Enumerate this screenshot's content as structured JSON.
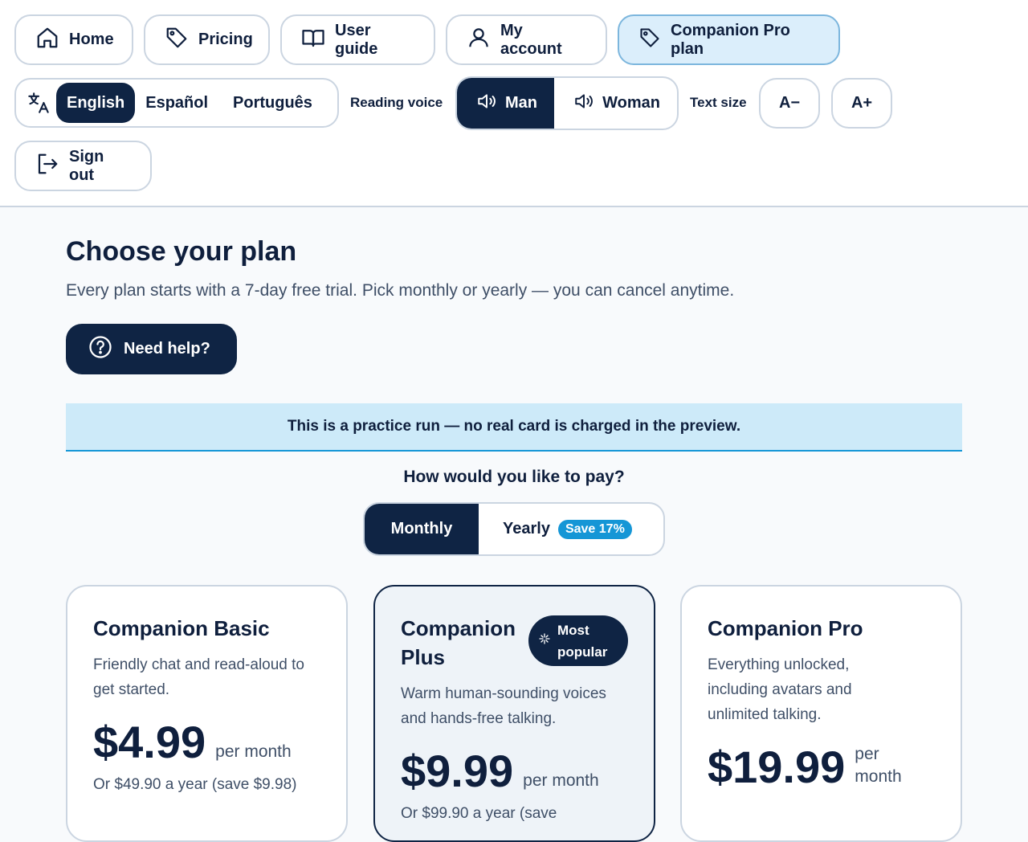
{
  "nav": {
    "home": "Home",
    "pricing": "Pricing",
    "user_guide": "User guide",
    "my_account": "My account",
    "pro_plan": "Companion Pro plan",
    "sign_out": "Sign out"
  },
  "language": {
    "options": [
      "English",
      "Español",
      "Português"
    ],
    "selected": "English"
  },
  "voice": {
    "label": "Reading voice",
    "options": [
      "Man",
      "Woman"
    ],
    "selected": "Man"
  },
  "text_size": {
    "label": "Text size",
    "decrease": "A−",
    "increase": "A+"
  },
  "page": {
    "title": "Choose your plan",
    "subtitle": "Every plan starts with a 7-day free trial. Pick monthly or yearly — you can cancel anytime.",
    "help_button": "Need help?",
    "notice": "This is a practice run — no real card is charged in the preview.",
    "pay_question": "How would you like to pay?"
  },
  "billing": {
    "monthly": "Monthly",
    "yearly": "Yearly",
    "save_badge": "Save 17%",
    "selected": "Monthly"
  },
  "plans": [
    {
      "name": "Companion Basic",
      "description": "Friendly chat and read-aloud to get started.",
      "price": "$4.99",
      "period": "per month",
      "yearly_note": "Or $49.90 a year (save $9.98)"
    },
    {
      "name": "Companion Plus",
      "badge": "Most popular",
      "description": "Warm human-sounding voices and hands-free talking.",
      "price": "$9.99",
      "period": "per month",
      "yearly_note": "Or $99.90 a year (save"
    },
    {
      "name": "Companion Pro",
      "description": "Everything unlocked, including avatars and unlimited talking.",
      "price": "$19.99",
      "period": "per month"
    }
  ],
  "colors": {
    "navy": "#0f2444",
    "accent": "#1596d6",
    "notice_bg": "#cdeaf9",
    "active_tab_bg": "#dbeefb"
  }
}
